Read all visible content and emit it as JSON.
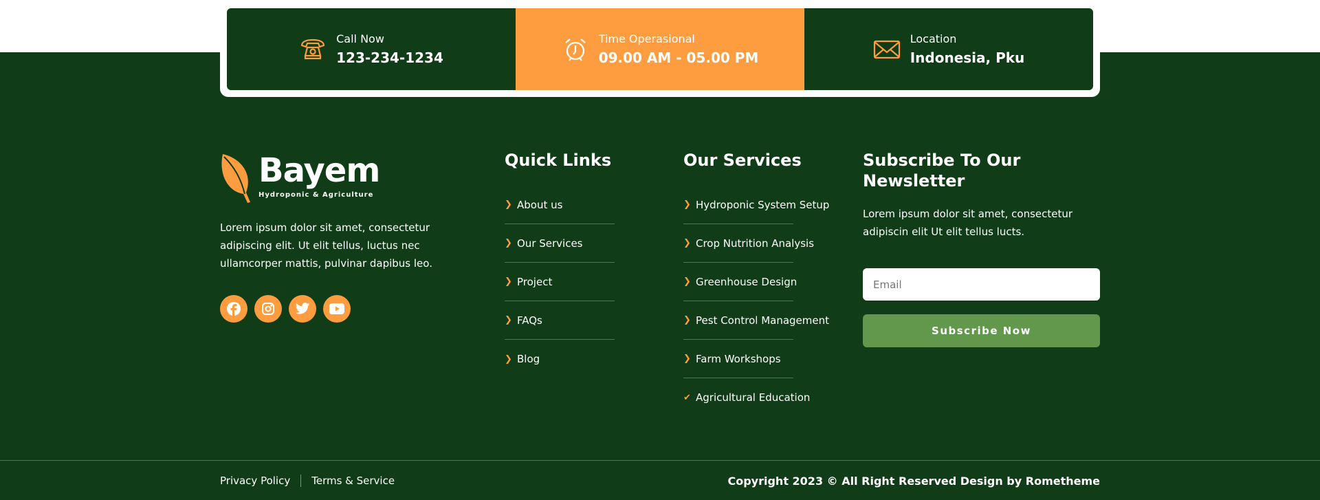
{
  "topbar": [
    {
      "label": "Call Now",
      "value": "123-234-1234",
      "icon": "phone-icon"
    },
    {
      "label": "Time Operasional",
      "value": "09.00 AM - 05.00 PM",
      "icon": "alarm-clock-icon"
    },
    {
      "label": "Location",
      "value": "Indonesia, Pku",
      "icon": "envelope-icon"
    }
  ],
  "brand": {
    "name": "Bayem",
    "tagline": "Hydroponic & Agriculture",
    "description": "Lorem ipsum dolor sit amet, consectetur adipiscing elit. Ut elit tellus, luctus nec ullamcorper mattis, pulvinar dapibus leo."
  },
  "social": [
    "facebook-icon",
    "instagram-icon",
    "twitter-icon",
    "youtube-icon"
  ],
  "quick_links": {
    "title": "Quick Links",
    "items": [
      "About us",
      "Our Services",
      "Project",
      "FAQs",
      "Blog"
    ]
  },
  "services": {
    "title": "Our Services",
    "items": [
      "Hydroponic System Setup",
      "Crop Nutrition Analysis",
      "Greenhouse Design",
      "Pest Control Management",
      "Farm Workshops",
      "Agricultural Education"
    ]
  },
  "newsletter": {
    "title": "Subscribe To Our Newsletter",
    "text": "Lorem ipsum dolor sit amet, consectetur adipiscin elit Ut elit tellus lucts.",
    "email_placeholder": "Email",
    "button": "Subscribe Now"
  },
  "bottom": {
    "links": [
      "Privacy Policy",
      "Terms & Service"
    ],
    "copyright": "Copyright 2023 © All Right Reserved Design by Rometheme"
  },
  "colors": {
    "green": "#113c18",
    "orange": "#fd9d40",
    "button": "#61984c"
  }
}
